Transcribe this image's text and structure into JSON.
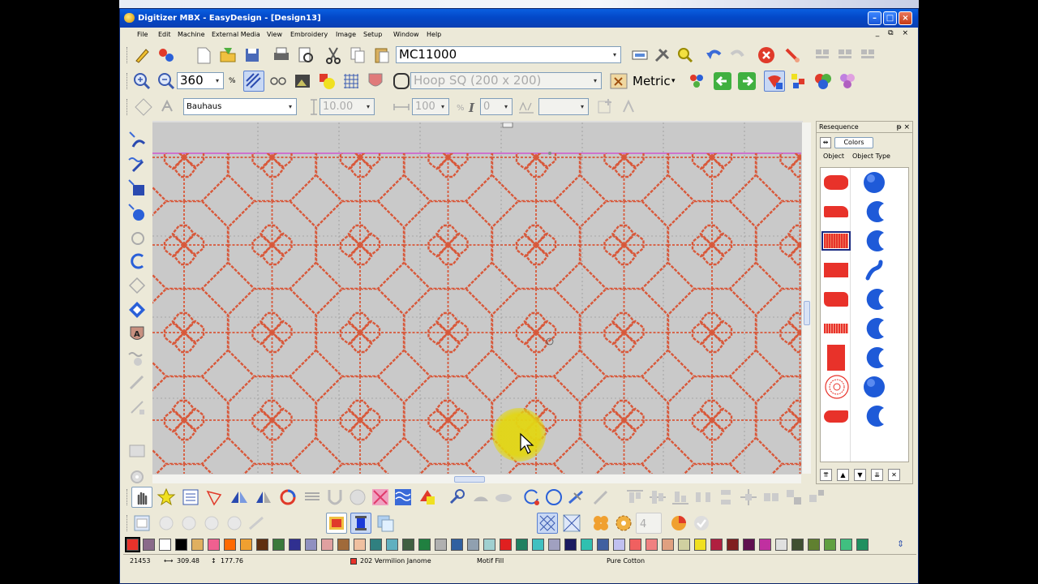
{
  "window": {
    "title": "Digitizer MBX - EasyDesign - [Design13]",
    "minimize": "–",
    "maximize": "□",
    "close": "×",
    "mdi_controls": "_ ⧉ ×"
  },
  "menu": [
    "File",
    "Edit",
    "Machine",
    "External Media",
    "View",
    "Embroidery",
    "Image",
    "Setup",
    "Window",
    "Help"
  ],
  "toolbar1": {
    "machine": "MC11000"
  },
  "toolbar2": {
    "zoom": "360",
    "zoom_unit": "%",
    "hoop": "Hoop SQ (200 x 200)",
    "units": "Metric"
  },
  "toolbar3": {
    "font": "Bauhaus",
    "height": "10.00",
    "width": "100",
    "slant": "0",
    "combo_arrow": "▾"
  },
  "panel": {
    "title": "Resequence",
    "pin": "ᵽ",
    "close": "×",
    "order_icon": "⇹",
    "colors_button": "Colors",
    "col_object": "Object",
    "col_object_type": "Object Type",
    "nav": [
      "⇈",
      "▲",
      "▼",
      "⇊",
      "✕"
    ],
    "rows": [
      {
        "shape": "ellipse",
        "type": "circle",
        "color": "#e8322a"
      },
      {
        "shape": "wedge",
        "type": "crescent",
        "color": "#e8322a"
      },
      {
        "shape": "rect-wide",
        "type": "crescent",
        "color": "#e8322a",
        "selected": true
      },
      {
        "shape": "rect",
        "type": "stroke",
        "color": "#e8322a"
      },
      {
        "shape": "rect-ragged",
        "type": "crescent",
        "color": "#e8322a"
      },
      {
        "shape": "rect-dotted",
        "type": "crescent",
        "color": "#e8322a"
      },
      {
        "shape": "tall-rect",
        "type": "crescent",
        "color": "#e8322a"
      },
      {
        "shape": "rosette",
        "type": "circle",
        "color": "#e8322a"
      },
      {
        "shape": "blob",
        "type": "crescent",
        "color": "#e8322a"
      }
    ]
  },
  "palette": [
    "#e8322a",
    "#8a6a8a",
    "#ffffff",
    "#000000",
    "#e0b060",
    "#f06090",
    "#ff6a00",
    "#f0a030",
    "#603010",
    "#3a7a3a",
    "#303090",
    "#9090c0",
    "#e0a0a0",
    "#a06a3a",
    "#f0c0a0",
    "#308080",
    "#60b0c0",
    "#406040",
    "#208040",
    "#b0b0b0",
    "#3060a0",
    "#90a0b0",
    "#a0d0d0",
    "#e02020",
    "#208060",
    "#40c0c0",
    "#a0a0c0",
    "#1a1a60",
    "#30c0b0",
    "#4060a0",
    "#c0c0f0",
    "#f06060",
    "#f08080",
    "#e0a080",
    "#d0d0a0",
    "#f0e020",
    "#b02040",
    "#802020",
    "#601050",
    "#c030a0",
    "#e0e0e0",
    "#405030",
    "#608030",
    "#60a040",
    "#40c080",
    "#209060"
  ],
  "palette_scroll": "⇕",
  "status": {
    "stitches": "21453",
    "width": "309.48",
    "height": "177.76",
    "thread": "202 Vermilion Janome",
    "fill_type": "Motif Fill",
    "material": "Pure Cotton"
  }
}
